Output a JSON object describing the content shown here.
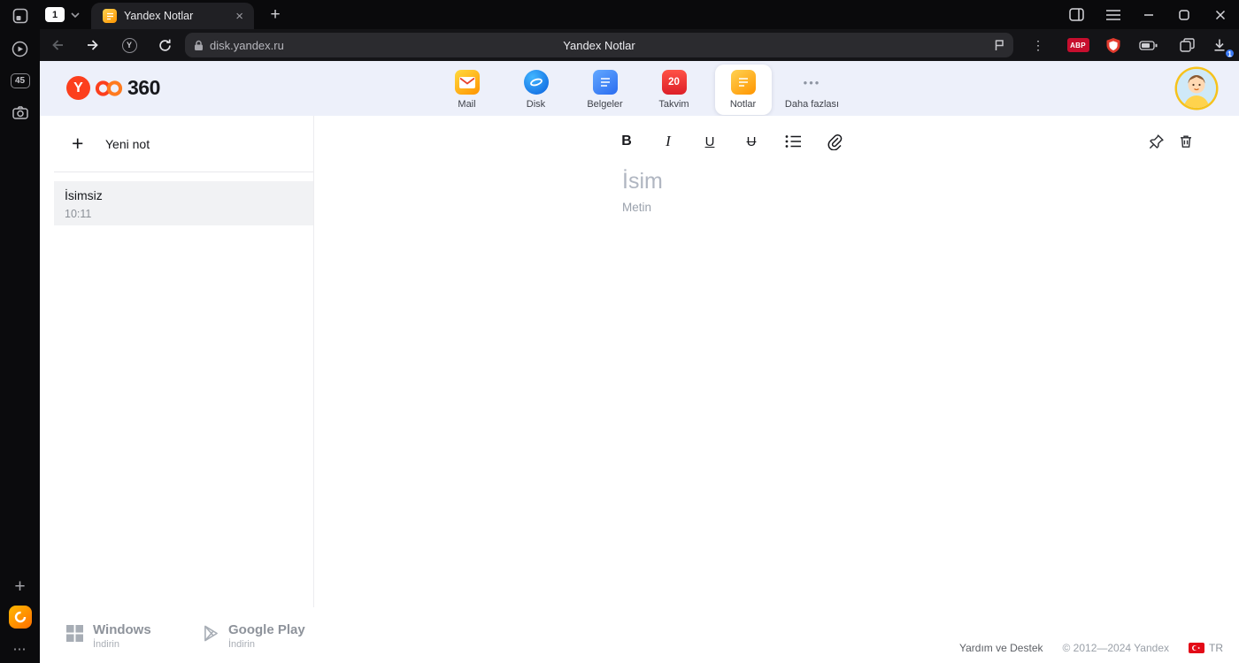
{
  "window": {
    "tab_group_count": "1",
    "tab_title": "Yandex Notlar",
    "sidebar_tab_count": "45"
  },
  "address_bar": {
    "url": "disk.yandex.ru",
    "page_title": "Yandex Notlar",
    "protect_letter": "Y"
  },
  "extensions": {
    "adblock_label": "ABP",
    "download_badge": "1"
  },
  "icons": {
    "plus": "+",
    "tab_close": "×",
    "dots_vertical": "⋮",
    "dots_more": "⋯",
    "service_more": "•••"
  },
  "header": {
    "logo_letter": "Y",
    "logo_text": "360",
    "services": [
      {
        "label": "Mail"
      },
      {
        "label": "Disk"
      },
      {
        "label": "Belgeler"
      },
      {
        "label": "Takvim",
        "badge": "20"
      },
      {
        "label": "Notlar"
      },
      {
        "label": "Daha fazlası"
      }
    ]
  },
  "notes_panel": {
    "new_note_label": "Yeni not",
    "items": [
      {
        "title": "İsimsiz",
        "time": "10:11"
      }
    ]
  },
  "editor": {
    "toolbar": {
      "bold": "B",
      "italic": "I",
      "underline": "U",
      "strikethrough": "U"
    },
    "title_placeholder": "İsim",
    "body_placeholder": "Metin"
  },
  "footer": {
    "windows_title": "Windows",
    "windows_subtitle": "İndirin",
    "gplay_title": "Google Play",
    "gplay_subtitle": "İndirin",
    "help_label": "Yardım ve Destek",
    "copyright": "© 2012—2024 Yandex",
    "language": "TR"
  },
  "colors": {
    "accent_red": "#fc3f1d",
    "header_bg": "#edf0fa",
    "selected_note_bg": "#f1f2f4",
    "download_badge_bg": "#3a79f3"
  }
}
